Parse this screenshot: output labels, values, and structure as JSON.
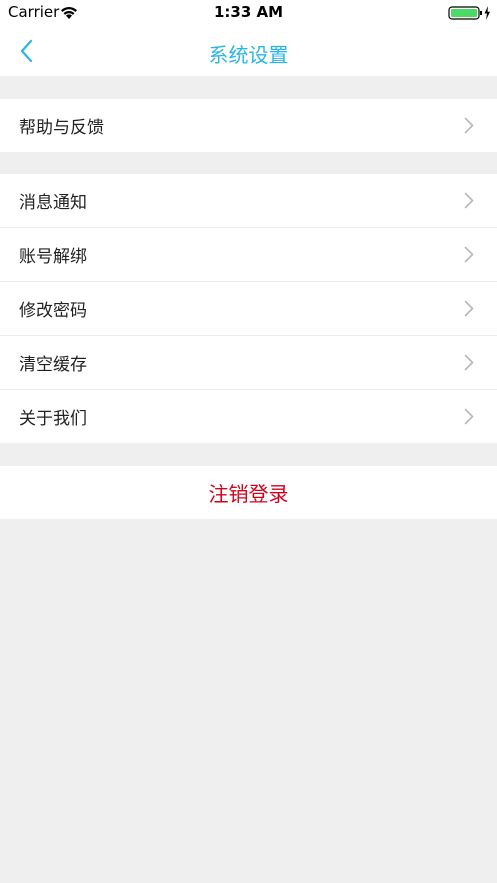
{
  "status_bar": {
    "carrier": "Carrier",
    "time": "1:33 AM"
  },
  "nav": {
    "title": "系统设置",
    "back_icon": "chevron-left-icon",
    "accent_color": "#2bb5e5"
  },
  "groups": [
    {
      "items": [
        {
          "label": "帮助与反馈",
          "icon": "chevron-right-icon"
        }
      ]
    },
    {
      "items": [
        {
          "label": "消息通知",
          "icon": "chevron-right-icon"
        },
        {
          "label": "账号解绑",
          "icon": "chevron-right-icon"
        },
        {
          "label": "修改密码",
          "icon": "chevron-right-icon"
        },
        {
          "label": "清空缓存",
          "icon": "chevron-right-icon"
        },
        {
          "label": "关于我们",
          "icon": "chevron-right-icon"
        }
      ]
    }
  ],
  "logout": {
    "label": "注销登录",
    "color": "#d0021b"
  },
  "colors": {
    "background": "#efefef",
    "card": "#ffffff",
    "battery": "#4cd964"
  }
}
